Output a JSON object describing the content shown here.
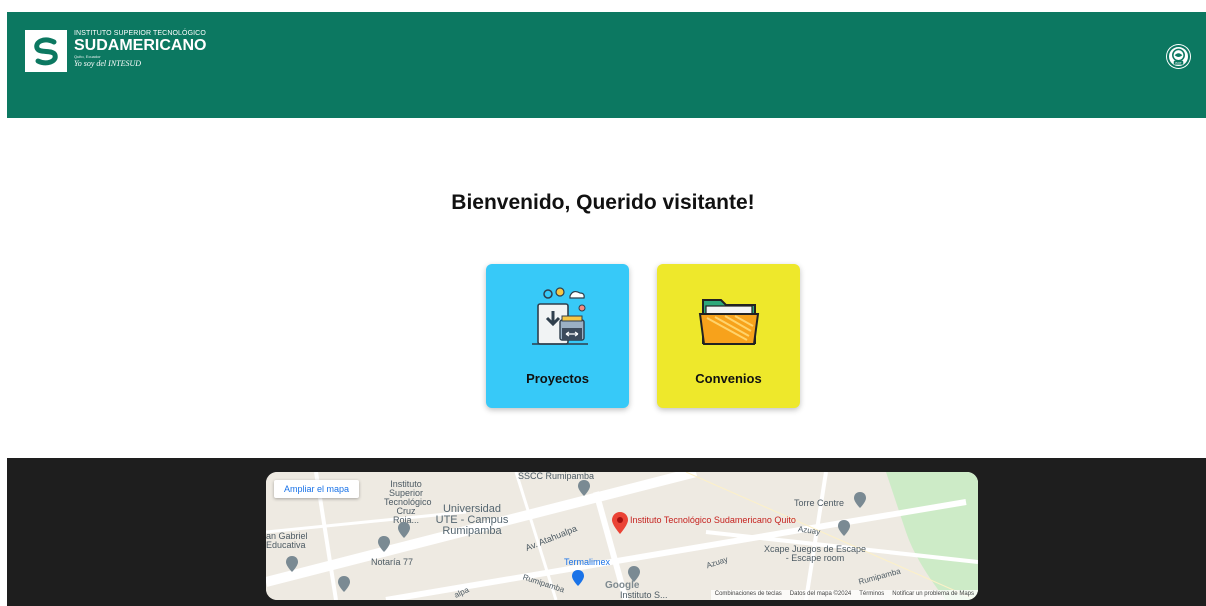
{
  "header": {
    "logo": {
      "line1": "INSTITUTO SUPERIOR TECNOLÓGICO",
      "line2": "SUDAMERICANO",
      "line3": "Quito, Ecuador",
      "line4": "Yo soy del INTESUD"
    },
    "exit_icon": "exit-icon",
    "exit_label": "EXIT"
  },
  "main": {
    "welcome": "Bienvenido, Querido visitante!",
    "cards": [
      {
        "label": "Proyectos",
        "color": "#37c9f8",
        "icon": "document-archive-icon"
      },
      {
        "label": "Convenios",
        "color": "#eee82b",
        "icon": "folder-icon"
      }
    ]
  },
  "colors": {
    "header": "#0c7861",
    "footer": "#1e1e1e"
  },
  "map": {
    "enlarge": "Ampliar el mapa",
    "places": {
      "instituto_superior": "Instituto Superior Tecnológico Cruz Roja...",
      "universidad": "Universidad UTE - Campus Rumipamba",
      "sscc": "SSCC Rumipamba",
      "san_gabriel": "an Gabriel Educativa",
      "notaria": "Notaría 77",
      "termalimex": "Termalimex",
      "torre": "Torre Centre",
      "xcape": "Xcape Juegos de Escape - Escape room",
      "pin": "Instituto Tecnológico Sudamericano Quito",
      "instituto_s": "Instituto S..."
    },
    "streets": {
      "atahualpa": "Av. Atahualpa",
      "rumipamba1": "Rumipamba",
      "rumipamba2": "Rumipamba",
      "azuay1": "Azuay",
      "azuay2": "Azuay",
      "alpa": "alpa"
    },
    "google": "Google",
    "attribution": {
      "shortcuts": "Combinaciones de teclas",
      "data": "Datos del mapa ©2024",
      "terms": "Términos",
      "report": "Notificar un problema de Maps"
    }
  }
}
